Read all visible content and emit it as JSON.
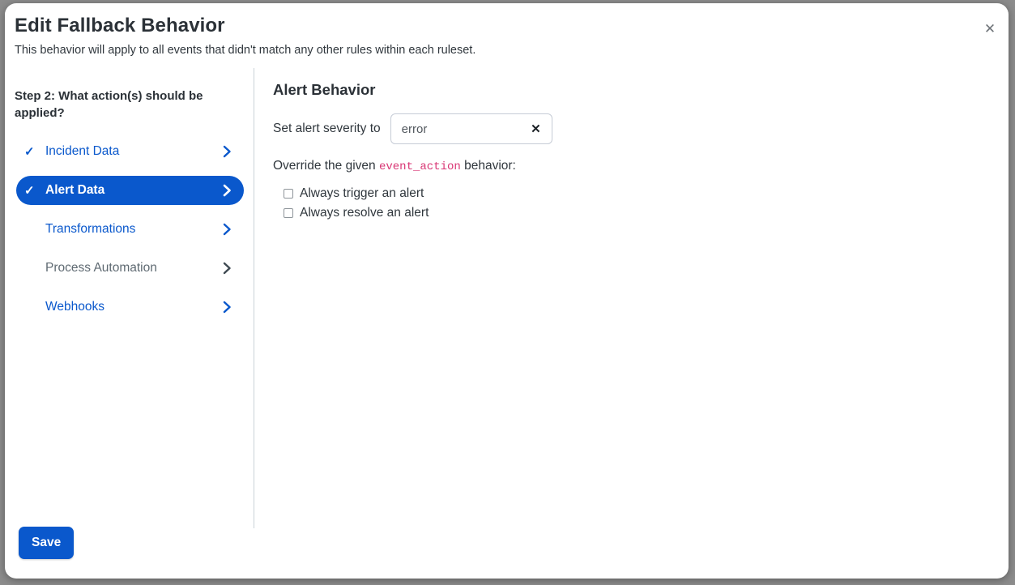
{
  "dialog": {
    "title": "Edit Fallback Behavior",
    "subtitle": "This behavior will apply to all events that didn't match any other rules within each ruleset.",
    "close_label": "✕",
    "accent_color": "#0a58cc",
    "code_color": "#d93775"
  },
  "sidebar": {
    "step_question": "Step 2: What action(s) should be applied?",
    "items": [
      {
        "label": "Incident Data",
        "checked": true,
        "state": "link",
        "check_glyph": "✓",
        "chevron": "chevron-right-icon"
      },
      {
        "label": "Alert Data",
        "checked": true,
        "state": "active",
        "check_glyph": "✓",
        "chevron": "chevron-right-icon"
      },
      {
        "label": "Transformations",
        "checked": false,
        "state": "link",
        "check_glyph": "✓",
        "chevron": "chevron-right-icon"
      },
      {
        "label": "Process Automation",
        "checked": false,
        "state": "disabled",
        "check_glyph": "✓",
        "chevron": "chevron-right-icon"
      },
      {
        "label": "Webhooks",
        "checked": false,
        "state": "link",
        "check_glyph": "✓",
        "chevron": "chevron-right-icon"
      }
    ]
  },
  "content": {
    "section_title": "Alert Behavior",
    "severity": {
      "label": "Set alert severity to",
      "value": "error",
      "clear_glyph": "✕"
    },
    "override": {
      "text_before": "Override the given ",
      "code": "event_action",
      "text_after": " behavior:",
      "options": [
        {
          "label": "Always trigger an alert",
          "checked": false
        },
        {
          "label": "Always resolve an alert",
          "checked": false
        }
      ]
    }
  },
  "footer": {
    "save_label": "Save"
  }
}
